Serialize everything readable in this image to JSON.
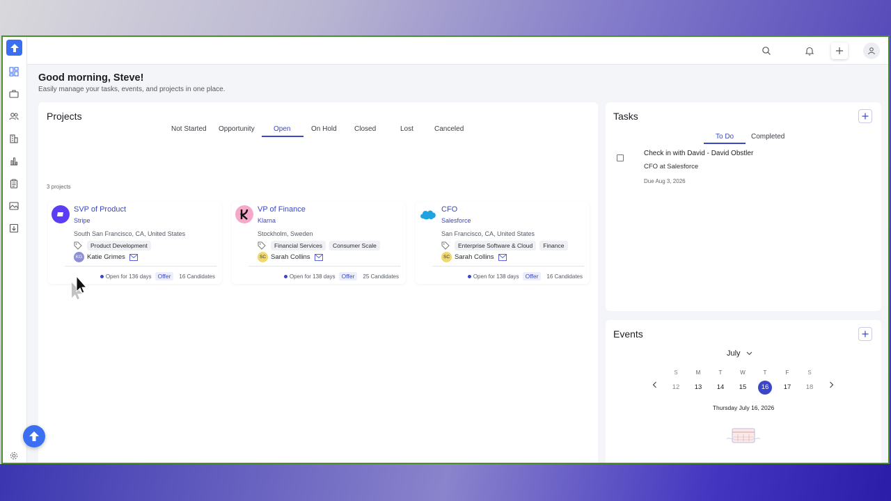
{
  "header": {
    "greeting": "Good morning, Steve!",
    "subtitle": "Easily manage your tasks, events, and projects in one place."
  },
  "sidebar": {
    "items": [
      {
        "icon": "dashboard-icon"
      },
      {
        "icon": "briefcase-icon"
      },
      {
        "icon": "people-icon"
      },
      {
        "icon": "building-icon"
      },
      {
        "icon": "bar-chart-icon"
      },
      {
        "icon": "clipboard-icon"
      },
      {
        "icon": "image-icon"
      },
      {
        "icon": "download-icon"
      }
    ],
    "settings_icon": "gear-icon"
  },
  "projects": {
    "title": "Projects",
    "tabs": [
      "Not Started",
      "Opportunity",
      "Open",
      "On Hold",
      "Closed",
      "Lost",
      "Canceled"
    ],
    "active_tab": "Open",
    "count_label": "3 projects",
    "cards": [
      {
        "title": "SVP of Product",
        "company": "Stripe",
        "location": "South San Francisco, CA, United States",
        "tags": [
          "Product Development"
        ],
        "owner": "Katie Grimes",
        "owner_initials": "KG",
        "open_for": "Open for 136 days",
        "stage": "Offer",
        "candidates": "16 Candidates"
      },
      {
        "title": "VP of Finance",
        "company": "Klarna",
        "location": "Stockholm, Sweden",
        "tags": [
          "Financial Services",
          "Consumer Scale"
        ],
        "owner": "Sarah Collins",
        "owner_initials": "SC",
        "open_for": "Open for 138 days",
        "stage": "Offer",
        "candidates": "25 Candidates"
      },
      {
        "title": "CFO",
        "company": "Salesforce",
        "location": "San Francisco, CA, United States",
        "tags": [
          "Enterprise Software & Cloud",
          "Finance"
        ],
        "owner": "Sarah Collins",
        "owner_initials": "SC",
        "open_for": "Open for 138 days",
        "stage": "Offer",
        "candidates": "16 Candidates"
      }
    ]
  },
  "tasks": {
    "title": "Tasks",
    "tabs": [
      "To Do",
      "Completed"
    ],
    "active_tab": "To Do",
    "items": [
      {
        "title": "Check in with David - David Obstler",
        "subtitle": "CFO at Salesforce",
        "due": "Due Aug 3, 2026"
      }
    ]
  },
  "events": {
    "title": "Events",
    "month": "July",
    "days": [
      {
        "name": "S",
        "num": "12"
      },
      {
        "name": "M",
        "num": "13"
      },
      {
        "name": "T",
        "num": "14"
      },
      {
        "name": "W",
        "num": "15"
      },
      {
        "name": "T",
        "num": "16"
      },
      {
        "name": "F",
        "num": "17"
      },
      {
        "name": "S",
        "num": "18"
      }
    ],
    "selected_day": "16",
    "selected_date_label": "Thursday July 16, 2026"
  },
  "colors": {
    "accent": "#3b46c8",
    "brand": "#3b6ff2",
    "panel": "#ffffff",
    "background": "#f4f5f8"
  }
}
